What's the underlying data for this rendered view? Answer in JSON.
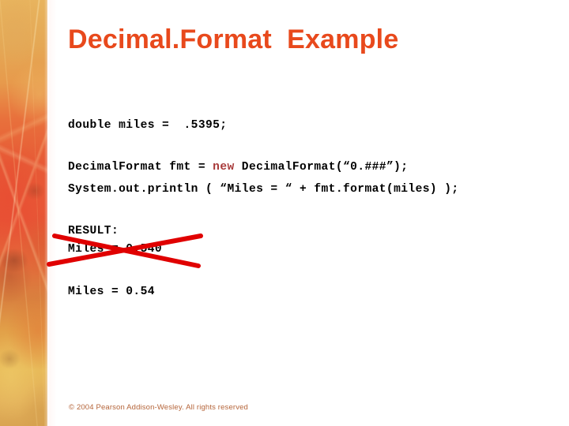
{
  "slide": {
    "title": "Decimal.Format  Example",
    "title_color": "#e8491c",
    "background_color": "#ffffff"
  },
  "decoration": {
    "left_strip": "autumn-leaves-photo-strip"
  },
  "code": {
    "declaration": "double miles =  .5395;",
    "format_line_prefix": "DecimalFormat fmt = ",
    "format_keyword": "new",
    "format_line_suffix": " DecimalFormat(“0.###”);",
    "println_line": "System.out.println ( “Miles = “ + fmt.format(miles) );",
    "keyword_color": "#a83a3a"
  },
  "result": {
    "label": "RESULT:",
    "crossed_out_value": "Miles = 0.540",
    "corrected_value": "Miles = 0.54",
    "strike_color": "#e00000"
  },
  "footer": {
    "text": "© 2004 Pearson Addison-Wesley. All rights reserved",
    "color": "#b5653a"
  }
}
